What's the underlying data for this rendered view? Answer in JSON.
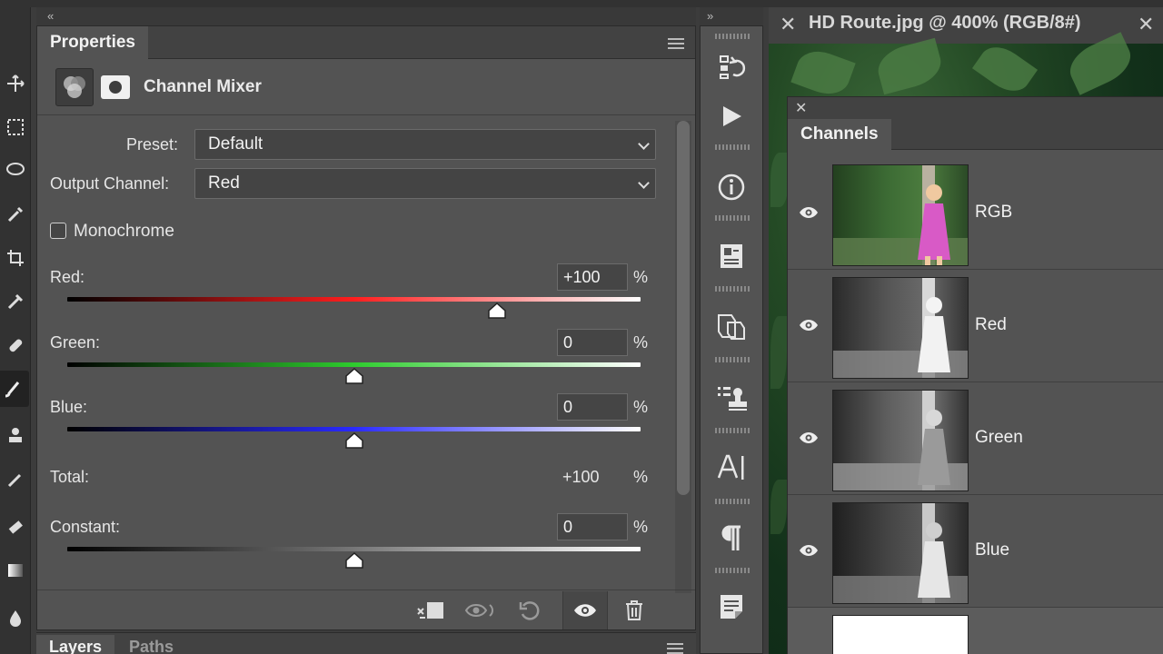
{
  "properties": {
    "tab": "Properties",
    "adjustment_title": "Channel Mixer",
    "preset_label": "Preset:",
    "preset_value": "Default",
    "output_label": "Output Channel:",
    "output_value": "Red",
    "monochrome_label": "Monochrome",
    "monochrome_checked": false,
    "sliders": [
      {
        "label": "Red:",
        "value": "+100",
        "unit": "%",
        "level": 200
      },
      {
        "label": "Green:",
        "value": "0",
        "unit": "%",
        "level": 100
      },
      {
        "label": "Blue:",
        "value": "0",
        "unit": "%",
        "level": 100
      }
    ],
    "total_label": "Total:",
    "total_value": "+100",
    "total_unit": "%",
    "constant_label": "Constant:",
    "constant_value": "0",
    "constant_unit": "%",
    "constant_level": 100
  },
  "bottom_panel": {
    "tabs": [
      "Layers",
      "Paths"
    ]
  },
  "document": {
    "title": "HD Route.jpg @ 400% (RGB/8#)"
  },
  "channels": {
    "tab": "Channels",
    "items": [
      "RGB",
      "Red",
      "Green",
      "Blue"
    ]
  },
  "colors": {
    "panel": "#535353",
    "dark": "#323232",
    "red": "#ff2020",
    "green": "#2ecc2e",
    "blue": "#2a2aff"
  }
}
